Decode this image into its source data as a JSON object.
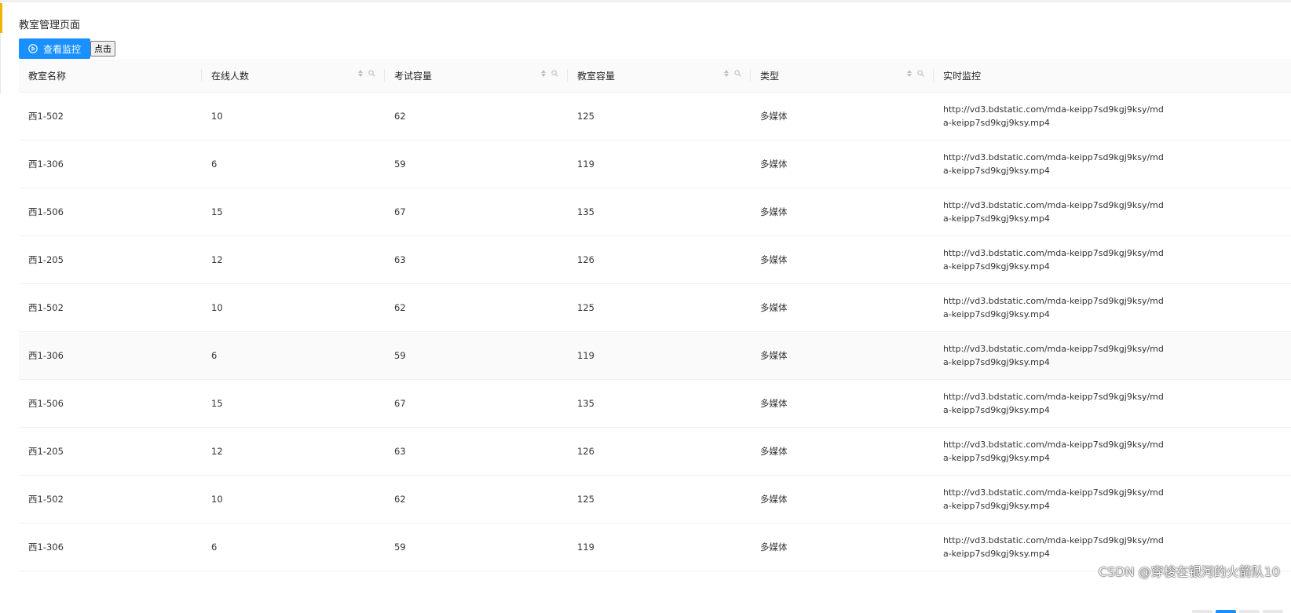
{
  "page": {
    "title": "教室管理页面"
  },
  "toolbar": {
    "monitor_button": "查看监控",
    "monitor_icon": "play-circle-icon",
    "click_button": "点击"
  },
  "table": {
    "columns": [
      {
        "label": "教室名称",
        "sortable": false
      },
      {
        "label": "在线人数",
        "sortable": true
      },
      {
        "label": "考试容量",
        "sortable": true
      },
      {
        "label": "教室容量",
        "sortable": true
      },
      {
        "label": "类型",
        "sortable": true
      },
      {
        "label": "实时监控",
        "sortable": false
      }
    ],
    "rows": [
      {
        "name": "西1-502",
        "online": "10",
        "exam_cap": "62",
        "room_cap": "125",
        "type": "多媒体",
        "url": "http://vd3.bdstatic.com/mda-keipp7sd9kgj9ksy/mda-keipp7sd9kgj9ksy.mp4"
      },
      {
        "name": "西1-306",
        "online": "6",
        "exam_cap": "59",
        "room_cap": "119",
        "type": "多媒体",
        "url": "http://vd3.bdstatic.com/mda-keipp7sd9kgj9ksy/mda-keipp7sd9kgj9ksy.mp4"
      },
      {
        "name": "西1-506",
        "online": "15",
        "exam_cap": "67",
        "room_cap": "135",
        "type": "多媒体",
        "url": "http://vd3.bdstatic.com/mda-keipp7sd9kgj9ksy/mda-keipp7sd9kgj9ksy.mp4"
      },
      {
        "name": "西1-205",
        "online": "12",
        "exam_cap": "63",
        "room_cap": "126",
        "type": "多媒体",
        "url": "http://vd3.bdstatic.com/mda-keipp7sd9kgj9ksy/mda-keipp7sd9kgj9ksy.mp4"
      },
      {
        "name": "西1-502",
        "online": "10",
        "exam_cap": "62",
        "room_cap": "125",
        "type": "多媒体",
        "url": "http://vd3.bdstatic.com/mda-keipp7sd9kgj9ksy/mda-keipp7sd9kgj9ksy.mp4"
      },
      {
        "name": "西1-306",
        "online": "6",
        "exam_cap": "59",
        "room_cap": "119",
        "type": "多媒体",
        "url": "http://vd3.bdstatic.com/mda-keipp7sd9kgj9ksy/mda-keipp7sd9kgj9ksy.mp4"
      },
      {
        "name": "西1-506",
        "online": "15",
        "exam_cap": "67",
        "room_cap": "135",
        "type": "多媒体",
        "url": "http://vd3.bdstatic.com/mda-keipp7sd9kgj9ksy/mda-keipp7sd9kgj9ksy.mp4"
      },
      {
        "name": "西1-205",
        "online": "12",
        "exam_cap": "63",
        "room_cap": "126",
        "type": "多媒体",
        "url": "http://vd3.bdstatic.com/mda-keipp7sd9kgj9ksy/mda-keipp7sd9kgj9ksy.mp4"
      },
      {
        "name": "西1-502",
        "online": "10",
        "exam_cap": "62",
        "room_cap": "125",
        "type": "多媒体",
        "url": "http://vd3.bdstatic.com/mda-keipp7sd9kgj9ksy/mda-keipp7sd9kgj9ksy.mp4"
      },
      {
        "name": "西1-306",
        "online": "6",
        "exam_cap": "59",
        "room_cap": "119",
        "type": "多媒体",
        "url": "http://vd3.bdstatic.com/mda-keipp7sd9kgj9ksy/mda-keipp7sd9kgj9ksy.mp4"
      }
    ],
    "highlighted_row": 5
  },
  "watermark": "CSDN @穿梭在银河的火箭队10",
  "colors": {
    "primary": "#1890ff",
    "accent": "#f0b400",
    "header_bg": "#fafafa",
    "border": "#f0f0f0"
  }
}
